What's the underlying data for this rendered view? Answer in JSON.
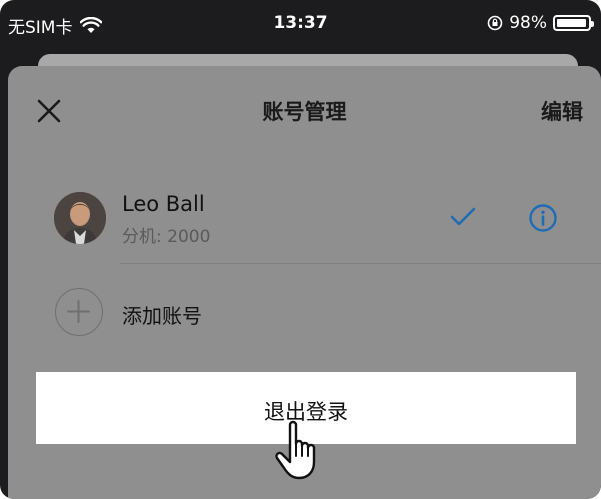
{
  "status_bar": {
    "carrier": "无SIM卡",
    "time": "13:37",
    "battery_text": "98%",
    "battery_level": 0.98
  },
  "sheet": {
    "title": "账号管理",
    "edit_label": "编辑"
  },
  "account": {
    "name": "Leo Ball",
    "extension": "分机: 2000"
  },
  "add_account_label": "添加账号",
  "logout_label": "退出登录",
  "colors": {
    "accent": "#1f6cb5",
    "sheet_bg": "#8f8f8f",
    "status_bg": "#1c1c1e"
  },
  "icons": [
    "wifi-icon",
    "orientation-lock-icon",
    "battery-icon",
    "close-icon",
    "checkmark-icon",
    "info-icon",
    "plus-icon",
    "hand-pointer-cursor-icon"
  ]
}
